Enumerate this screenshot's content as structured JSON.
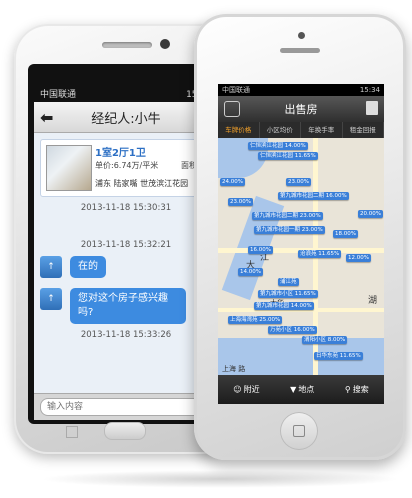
{
  "back_phone": {
    "status": {
      "carrier": "中国联通",
      "time": "15:33"
    },
    "title": "经纪人:小牛",
    "listing": {
      "title": "1室2厅1卫",
      "unit_price": "单价:6.74万/平米",
      "area": "面积",
      "address": "浦东 陆家嘴 世茂滨江花园"
    },
    "timestamps": [
      "2013-11-18 15:30:31",
      "2013-11-18 15:32:21",
      "2013-11-18 15:33:26"
    ],
    "right_bubble": "房",
    "messages": [
      "在的",
      "您对这个房子感兴趣吗?"
    ],
    "input_placeholder": "输入内容"
  },
  "front_phone": {
    "status": {
      "carrier": "中国联通",
      "time": "15:34"
    },
    "title": "出售房",
    "tabs": [
      "车牌价格",
      "小区均价",
      "年换手率",
      "租金回报"
    ],
    "active_tab": 0,
    "map_pins": [
      "仁恒滨江花园 14.00%",
      "仁恒滨江花园 11.65%",
      "24.00%",
      "23.00%",
      "第九城市花园二期 16.00%",
      "23.00%",
      "第九城市花园二期 23.00%",
      "20.00%",
      "第九城市花园一期 23.00%",
      "18.00%",
      "16.00%",
      "沧浪苑 11.65%",
      "12.00%",
      "14.00%",
      "浦江苑",
      "第九城市小区 11.65%",
      "第九城市花园 14.00%",
      "上海海湾苑 25.00%",
      "万苑小区 16.00%",
      "渭阳小区 8.00%",
      "日华东苑 11.65%"
    ],
    "map_labels": [
      "大",
      "江",
      "大华",
      "湖",
      "上海 路"
    ],
    "bottom": {
      "nearby": "附近",
      "point": "地点",
      "search": "搜索"
    }
  }
}
